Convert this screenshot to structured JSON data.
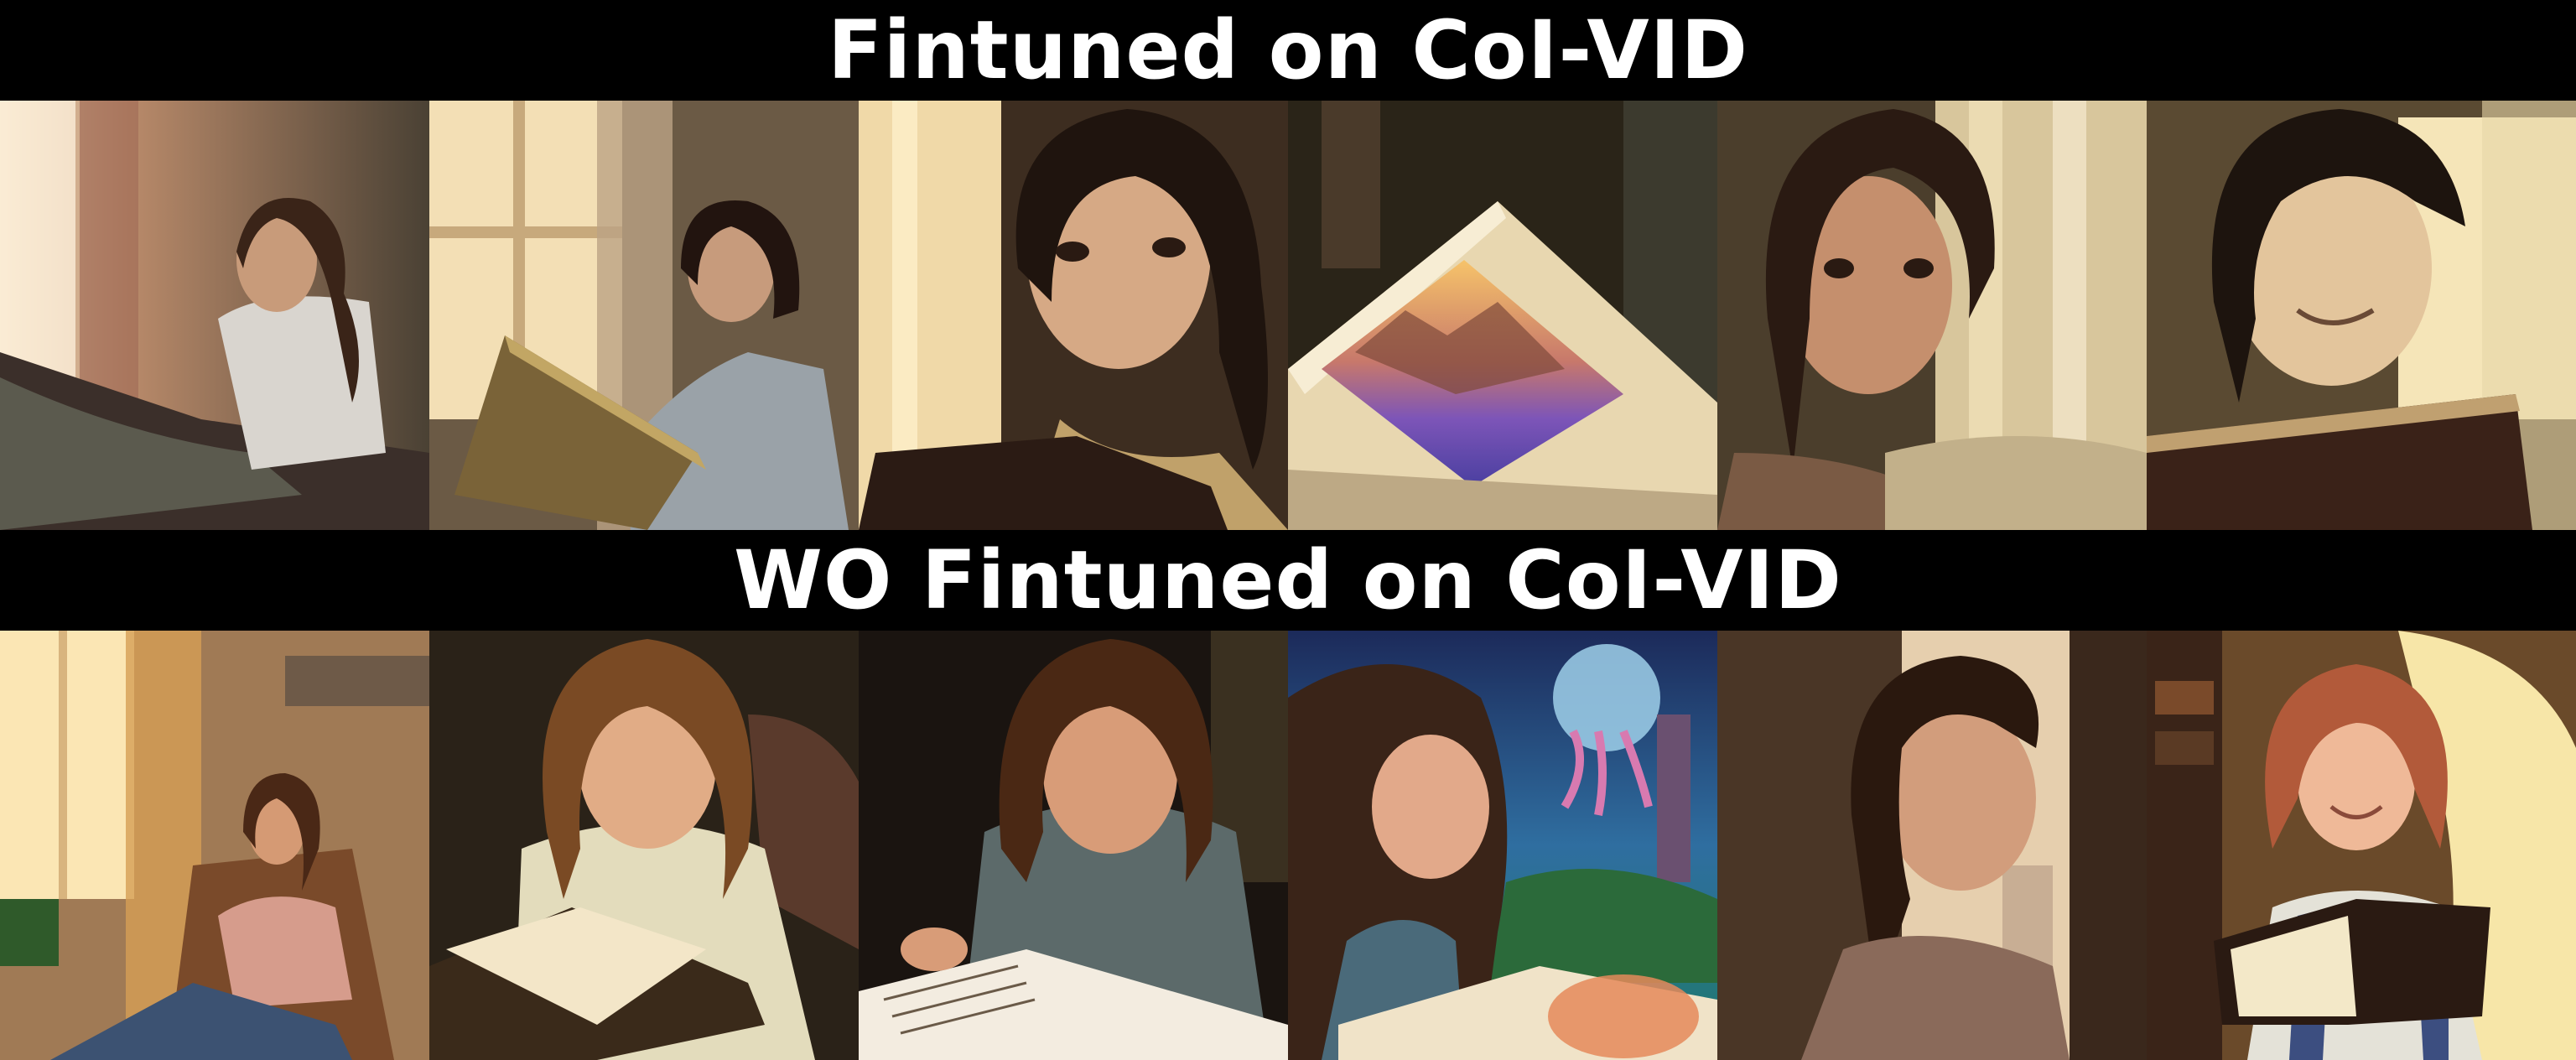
{
  "rows": [
    {
      "title": "Fintuned on CoI-VID",
      "frames": [
        {
          "scene": "woman-in-armchair-by-window"
        },
        {
          "scene": "woman-reading-book-by-window"
        },
        {
          "scene": "woman-closeup-with-book"
        },
        {
          "scene": "open-book-with-landscape-picture"
        },
        {
          "scene": "woman-closeup-by-curtain"
        },
        {
          "scene": "woman-smiling-with-book"
        }
      ]
    },
    {
      "title": "WO Fintuned on CoI-VID",
      "frames": [
        {
          "scene": "woman-in-armchair-by-window"
        },
        {
          "scene": "woman-reading-book-in-chair"
        },
        {
          "scene": "woman-reading-book-at-table"
        },
        {
          "scene": "woman-with-fantasy-book-scene"
        },
        {
          "scene": "woman-profile-by-window"
        },
        {
          "scene": "girl-smiling-with-book"
        }
      ]
    }
  ],
  "colors": {
    "background": "#000000",
    "title_text": "#ffffff"
  }
}
